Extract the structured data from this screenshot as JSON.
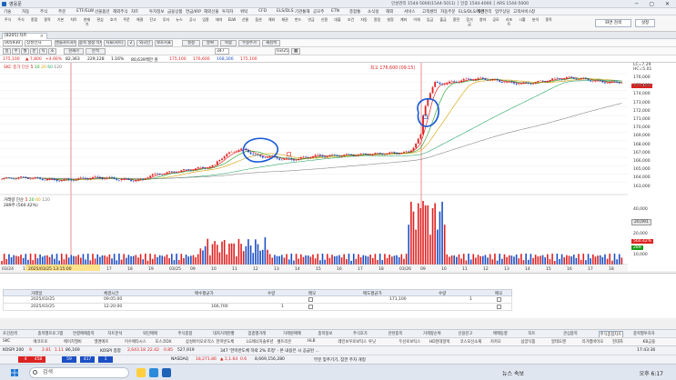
{
  "window": {
    "title": "영웅문",
    "info": "인성관리 1544-5000(1544-5011)   │ 인증 1544-4000   │ ARS 1544-5000",
    "controls": "─ ▢ ✕"
  },
  "menu": [
    "기술",
    "자동",
    "주식",
    "주문",
    "ETF/ELW",
    "선물옵션",
    "해외주식",
    "차트",
    "투자정보",
    "금융상품",
    "연금/IRP",
    "해외선물",
    "투자자",
    "위탁",
    "CFD",
    "ELS/DLS",
    "기관통해",
    "공모주",
    "ETN",
    "종합통",
    "소식실",
    "해외",
    "서비스",
    "고객센터",
    "자동주문",
    "ELS/DLS/채권",
    "자산관리",
    "업무상담",
    "고객서비스",
    "창"
  ],
  "toolbar": {
    "buttons": [
      "주식",
      "주식",
      "종합",
      "종목",
      "기본",
      "차트",
      "현재가",
      "관심",
      "호가",
      "주문",
      "체결",
      "잔고",
      "투자",
      "뉴스",
      "공시",
      "업종",
      "테마",
      "ELW",
      "선물",
      "옵션",
      "해외",
      "채권",
      "펀드",
      "연금",
      "신용",
      "대출",
      "조건",
      "자동",
      "알림",
      "설정",
      "계좌",
      "이체",
      "입금",
      "출금",
      "환전",
      "증거금",
      "청약",
      "공모",
      "리포트",
      "시황",
      "분석",
      "종목"
    ],
    "search_label": "화면 검색",
    "settings_label": "설정"
  },
  "tab": {
    "label": "[8205] 차트",
    "close": "×"
  },
  "controls_row1": {
    "code": "005930",
    "name": "삼성전자",
    "period_buttons": [
      "일",
      "주",
      "월",
      "분",
      "틱",
      "초"
    ],
    "chart_label": "캔들차트차트",
    "btn_a": "종목 설정 삭제",
    "btn_b": "지표(차트)",
    "btn_c": "2",
    "btn_d": "외국인",
    "btn_e": "보조지표",
    "btn_f": "설정",
    "btn_g": "날짜",
    "btn_h": "복합",
    "btn_i": "현재가",
    "btn_j": "분석",
    "btn_k": "수정주가",
    "btn_l": "재검색",
    "count": "347",
    "date": "03/25"
  },
  "controls_row2": {
    "price": "175,100",
    "change": "▲ 7,800",
    "pct": "+4.66%",
    "vol_lbl": "82,363",
    "turnover": "229,128",
    "ratio": "1.16%",
    "info": "80,639백만 원",
    "o": "175,100",
    "h": "176,600",
    "l": "168,300",
    "c": "175,100"
  },
  "chart_tab": {
    "name": "SKC",
    "ma_title": "종가 단순",
    "ma": [
      "5",
      "10",
      "20",
      "60",
      "120"
    ]
  },
  "annotations": {
    "high_label": "최고 176,600 (09:15)",
    "vol_title": "거래량 단순",
    "vol_ma": [
      "5",
      "20",
      "60",
      "120"
    ],
    "vol_pct": "(560.42%)",
    "vol_val": "289주"
  },
  "axis_right": {
    "top_badges": [
      "LC=7.29",
      "HC=5.01"
    ],
    "ticks": [
      "176,000",
      "175,000",
      "174,000",
      "173,000",
      "172,000",
      "171,000",
      "170,000",
      "169,000",
      "168,000",
      "167,000",
      "166,000",
      "165,000",
      "164,000",
      "163,000"
    ],
    "current_tag": "175,100",
    "vol_ticks": [
      "40,000",
      "30,000",
      "20,000",
      "10,000"
    ],
    "vol_tag1": "20,091",
    "vol_tag2": "560.42%",
    "vol_tag3": "289"
  },
  "x_axis": {
    "labels": [
      "03/24",
      "13",
      "14",
      "15",
      "16",
      "17",
      "18",
      "19",
      "03/25",
      "09",
      "10",
      "11",
      "12",
      "13",
      "14",
      "15",
      "16",
      "17",
      "18",
      "03/26",
      "09",
      "10",
      "11",
      "12",
      "13",
      "14",
      "15",
      "16",
      "17",
      "18"
    ],
    "selected": "2025/03/25 13:15:00"
  },
  "order_grid": {
    "headers": [
      "거래일",
      "체결시간",
      "매수평균가",
      "수량",
      "메모",
      "매도평균가",
      "수량",
      "메모"
    ],
    "rows": [
      {
        "date": "2025/03/25",
        "time": "09:05:00",
        "buy_avg": "",
        "buy_qty": "",
        "sell_avg": "171,100",
        "sell_qty": "1"
      },
      {
        "date": "2025/03/25",
        "time": "12:20:00",
        "buy_avg": "166,700",
        "buy_qty": "1",
        "sell_avg": "",
        "sell_qty": ""
      }
    ]
  },
  "bottom_tabs": [
    "조건검색",
    "종목별프로그램",
    "연결매매종목",
    "차트분석",
    "외인매매",
    "주식종합",
    "대차거래현황",
    "업종별거래",
    "거래원매매",
    "종목정보",
    "주식호가",
    "관련종목",
    "거래량순위",
    "신용잔고",
    "매매동향",
    "차트",
    "관심종목",
    "주식종합차트",
    "종목별투자자"
  ],
  "fav_bar": [
    "SKC",
    "에코프로",
    "에이치엘비",
    "엘앤에프",
    "이수페타시스",
    "포스코DX",
    "삼성바이오로직스",
    "한미반도체",
    "LG에너지솔루션",
    "셀트리온",
    "HLB",
    "레인보우로보틱스",
    "루닛",
    "두산로보틱스",
    "HD현대일렉",
    "코스모신소재",
    "카카오",
    "삼양식품",
    "알테오젠",
    "리가켐바이오",
    "현대차",
    "KB금융"
  ],
  "status": {
    "kospi_label": "KOSPI 200",
    "kospi_vals": [
      "9",
      "2.81",
      "1.11",
      "86,169"
    ],
    "kosdaq_label": "KOSPI 종합",
    "kosdaq_vals": [
      "2,643.18",
      "22.42",
      "0.85",
      "527,919"
    ],
    "news": "347  '한미반도체 하락 2% 조정' - 본 내용은 시 공급된 ...",
    "extra": [
      "4",
      "458",
      "59",
      "417",
      "1"
    ],
    "nasdaq_label": "NASDAQ",
    "nasdaq_vals": [
      "18,271.86",
      "▲ 1,1.64",
      "0.6",
      "8,669,156,280"
    ],
    "msg": "부분 맞추기기, 잠깐 주차 개정",
    "time": "17:43:36"
  },
  "taskbar": {
    "search": "검색",
    "news": "뉴스 속보",
    "time": "오후 6:17"
  },
  "colors": {
    "accent": "#1e63b8",
    "up": "#d22222",
    "down": "#1c4fc4"
  }
}
